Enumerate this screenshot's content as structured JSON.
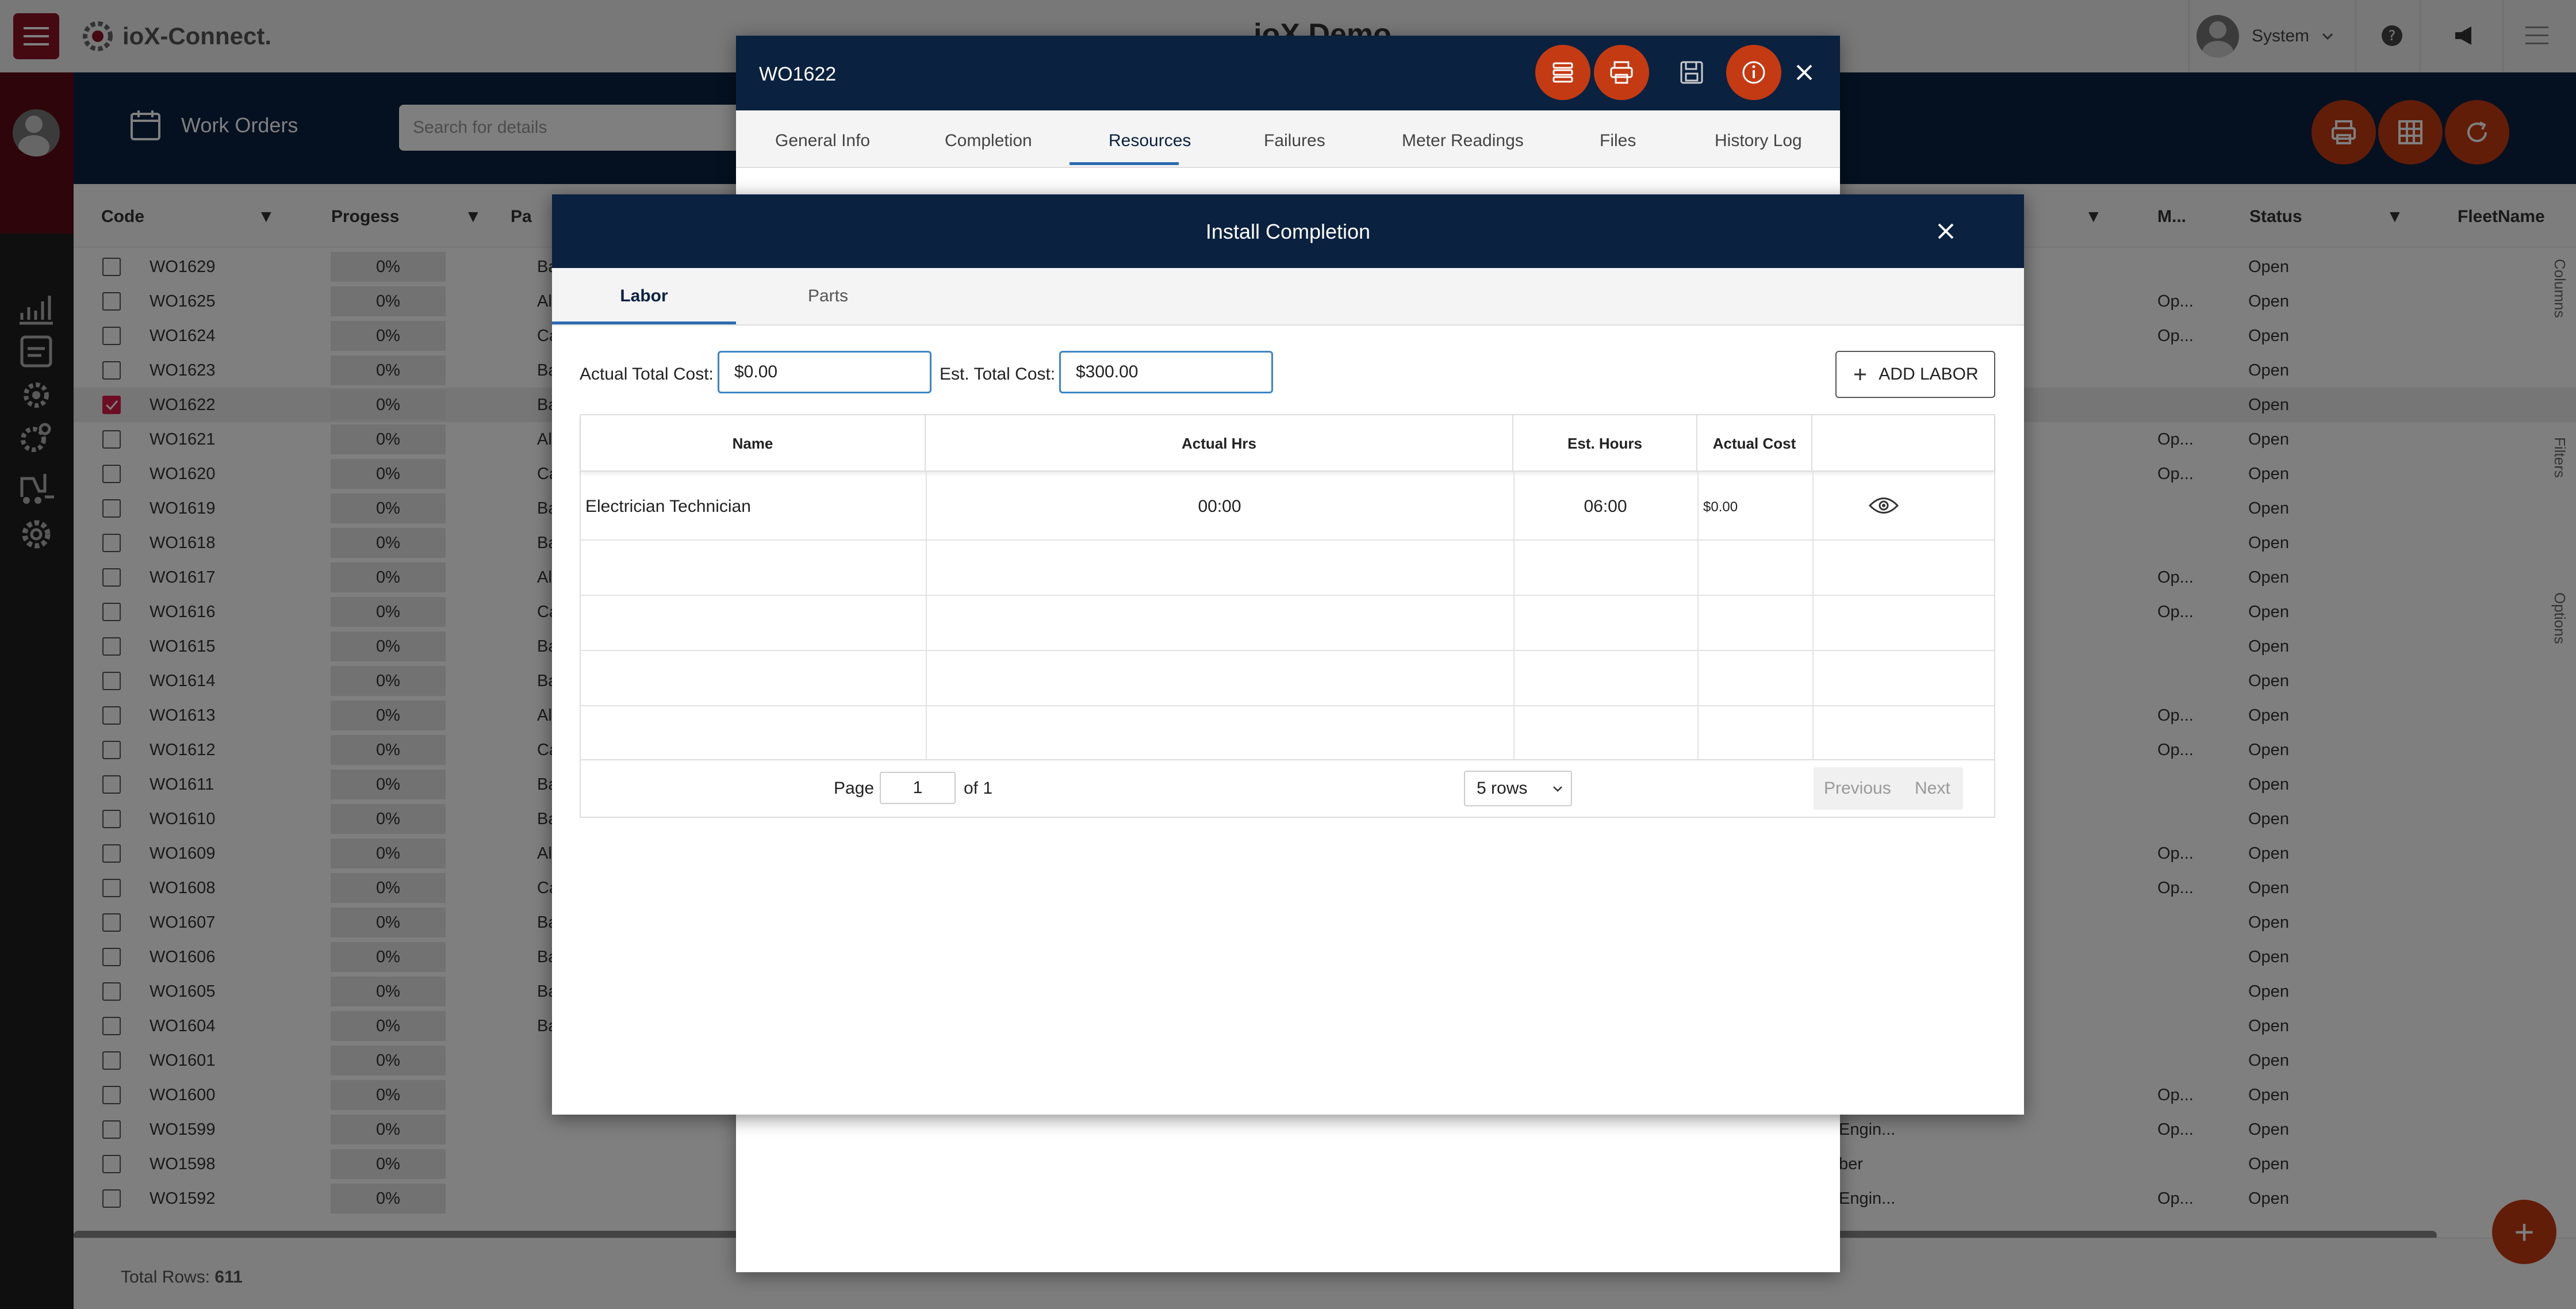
{
  "app": {
    "brand": "ioX-Connect.",
    "title": "ioX Demo",
    "user": "System"
  },
  "header": {
    "section_title": "Work Orders",
    "search_placeholder": "Search for details"
  },
  "grid": {
    "columns": {
      "code": "Code",
      "progress": "Progess",
      "col3": "Pa",
      "m": "M...",
      "status": "Status",
      "fleet": "FleetName"
    },
    "rows": [
      {
        "code": "WO1629",
        "progress": "0%",
        "pc": "Ba",
        "m": "",
        "status": "Open",
        "checked": false,
        "fs": ""
      },
      {
        "code": "WO1625",
        "progress": "0%",
        "pc": "Al",
        "m": "Op...",
        "status": "Open",
        "checked": false,
        "fs": ""
      },
      {
        "code": "WO1624",
        "progress": "0%",
        "pc": "Ca",
        "m": "Op...",
        "status": "Open",
        "checked": false,
        "fs": ""
      },
      {
        "code": "WO1623",
        "progress": "0%",
        "pc": "Ba",
        "m": "",
        "status": "Open",
        "checked": false,
        "fs": ""
      },
      {
        "code": "WO1622",
        "progress": "0%",
        "pc": "Ba",
        "m": "",
        "status": "Open",
        "checked": true,
        "fs": ""
      },
      {
        "code": "WO1621",
        "progress": "0%",
        "pc": "Al",
        "m": "Op...",
        "status": "Open",
        "checked": false,
        "fs": ""
      },
      {
        "code": "WO1620",
        "progress": "0%",
        "pc": "Ca",
        "m": "Op...",
        "status": "Open",
        "checked": false,
        "fs": ""
      },
      {
        "code": "WO1619",
        "progress": "0%",
        "pc": "Ba",
        "m": "",
        "status": "Open",
        "checked": false,
        "fs": ""
      },
      {
        "code": "WO1618",
        "progress": "0%",
        "pc": "Ba",
        "m": "",
        "status": "Open",
        "checked": false,
        "fs": ""
      },
      {
        "code": "WO1617",
        "progress": "0%",
        "pc": "Al",
        "m": "Op...",
        "status": "Open",
        "checked": false,
        "fs": ""
      },
      {
        "code": "WO1616",
        "progress": "0%",
        "pc": "Ca",
        "m": "Op...",
        "status": "Open",
        "checked": false,
        "fs": ""
      },
      {
        "code": "WO1615",
        "progress": "0%",
        "pc": "Ba",
        "m": "",
        "status": "Open",
        "checked": false,
        "fs": ""
      },
      {
        "code": "WO1614",
        "progress": "0%",
        "pc": "Ba",
        "m": "",
        "status": "Open",
        "checked": false,
        "fs": ""
      },
      {
        "code": "WO1613",
        "progress": "0%",
        "pc": "Al",
        "m": "Op...",
        "status": "Open",
        "checked": false,
        "fs": ""
      },
      {
        "code": "WO1612",
        "progress": "0%",
        "pc": "Ca",
        "m": "Op...",
        "status": "Open",
        "checked": false,
        "fs": ""
      },
      {
        "code": "WO1611",
        "progress": "0%",
        "pc": "Ba",
        "m": "",
        "status": "Open",
        "checked": false,
        "fs": ""
      },
      {
        "code": "WO1610",
        "progress": "0%",
        "pc": "Ba",
        "m": "",
        "status": "Open",
        "checked": false,
        "fs": ""
      },
      {
        "code": "WO1609",
        "progress": "0%",
        "pc": "Al",
        "m": "Op...",
        "status": "Open",
        "checked": false,
        "fs": ""
      },
      {
        "code": "WO1608",
        "progress": "0%",
        "pc": "Ca",
        "m": "Op...",
        "status": "Open",
        "checked": false,
        "fs": ""
      },
      {
        "code": "WO1607",
        "progress": "0%",
        "pc": "Ba",
        "m": "",
        "status": "Open",
        "checked": false,
        "fs": ""
      },
      {
        "code": "WO1606",
        "progress": "0%",
        "pc": "Ba",
        "m": "",
        "status": "Open",
        "checked": false,
        "fs": ""
      },
      {
        "code": "WO1605",
        "progress": "0%",
        "pc": "Ba",
        "m": "",
        "status": "Open",
        "checked": false,
        "fs": ""
      },
      {
        "code": "WO1604",
        "progress": "0%",
        "pc": "Ba",
        "m": "",
        "status": "Open",
        "checked": false,
        "fs": ""
      },
      {
        "code": "WO1601",
        "progress": "0%",
        "pc": "",
        "m": "",
        "status": "Open",
        "checked": false,
        "fs": ""
      },
      {
        "code": "WO1600",
        "progress": "0%",
        "pc": "",
        "m": "Op...",
        "status": "Open",
        "checked": false,
        "fs": ""
      },
      {
        "code": "WO1599",
        "progress": "0%",
        "pc": "",
        "m": "Op...",
        "status": "Open",
        "checked": false,
        "fs": "Engin..."
      },
      {
        "code": "WO1598",
        "progress": "0%",
        "pc": "",
        "m": "",
        "status": "Open",
        "checked": false,
        "fs": "ber"
      },
      {
        "code": "WO1592",
        "progress": "0%",
        "pc": "",
        "m": "Op...",
        "status": "Open",
        "checked": false,
        "fs": "Engin..."
      }
    ],
    "total_label": "Total Rows:",
    "total_value": "611"
  },
  "side_tabs": {
    "columns": "Columns",
    "filters": "Filters",
    "options": "Options"
  },
  "work_order_dialog": {
    "title": "WO1622",
    "tabs": [
      "General Info",
      "Completion",
      "Resources",
      "Failures",
      "Meter Readings",
      "Files",
      "History Log"
    ],
    "active_tab": "Resources"
  },
  "completion_dialog": {
    "title": "Install Completion",
    "tabs": {
      "labor": "Labor",
      "parts": "Parts"
    },
    "actual_total_cost_label": "Actual Total Cost:",
    "actual_total_cost_value": "$0.00",
    "est_total_cost_label": "Est. Total Cost:",
    "est_total_cost_value": "$300.00",
    "add_labor_label": "ADD LABOR",
    "table": {
      "headers": [
        "Name",
        "Actual Hrs",
        "Est. Hours",
        "Actual Cost"
      ],
      "rows": [
        {
          "name": "Electrician Technician",
          "actual_hrs": "00:00",
          "est_hours": "06:00",
          "actual_cost": "$0.00"
        }
      ]
    },
    "pager": {
      "page_label": "Page",
      "page_value": "1",
      "of_label": "of 1",
      "rows_option": "5 rows",
      "previous": "Previous",
      "next": "Next"
    }
  },
  "colors": {
    "brand_red": "#8a1322",
    "navy": "#0a2240",
    "accent_orange": "#c43a12",
    "tab_underline": "#2a6bb0"
  }
}
